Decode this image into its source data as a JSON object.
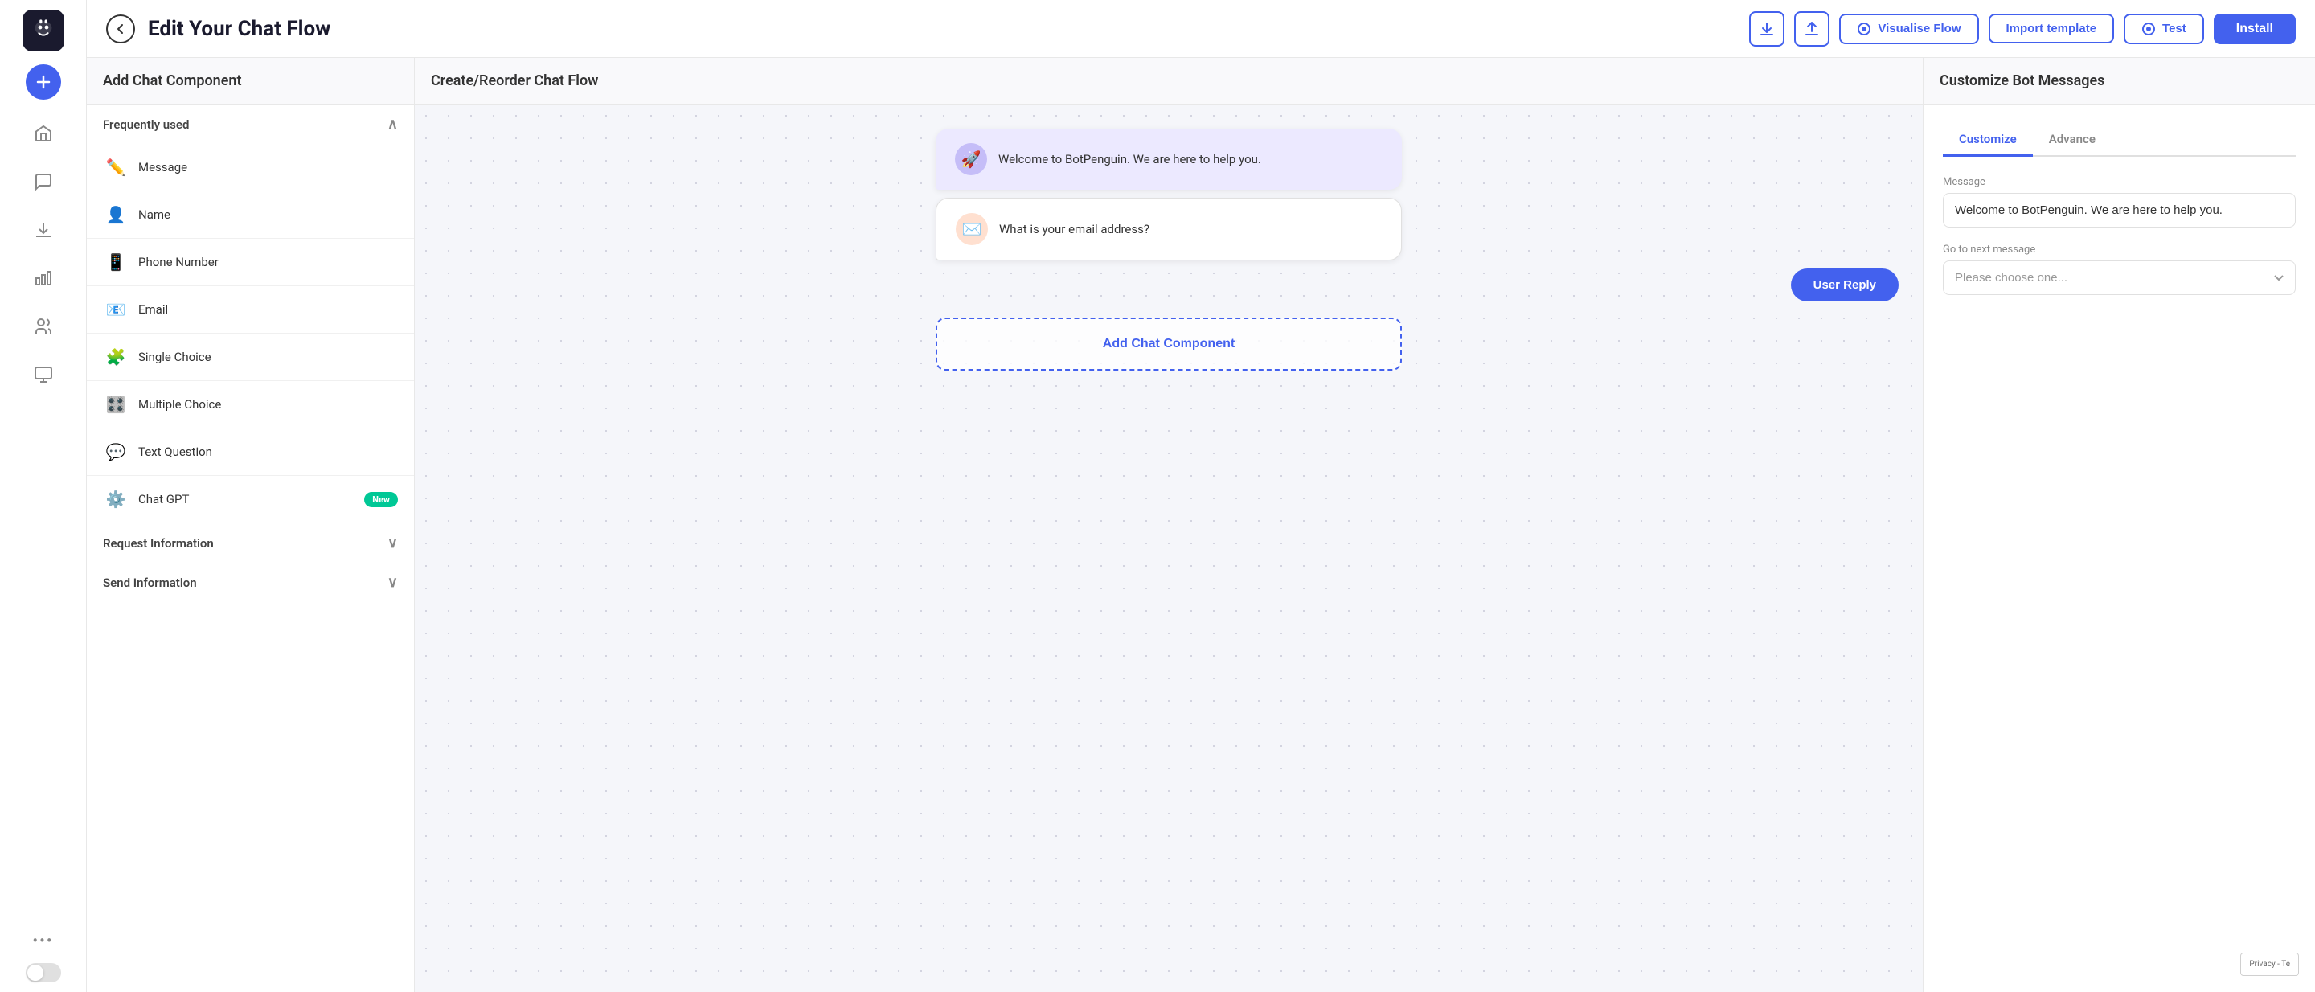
{
  "app": {
    "logo_alt": "BotPenguin Logo"
  },
  "sidebar": {
    "add_button_label": "+",
    "nav_items": [
      {
        "name": "home",
        "icon": "home"
      },
      {
        "name": "chat",
        "icon": "chat"
      },
      {
        "name": "download",
        "icon": "download"
      },
      {
        "name": "analytics",
        "icon": "analytics"
      },
      {
        "name": "users",
        "icon": "users"
      },
      {
        "name": "display",
        "icon": "display"
      }
    ],
    "more_label": "•••"
  },
  "header": {
    "title": "Edit Your Chat Flow",
    "back_label": "←",
    "download_icon": "download",
    "upload_icon": "upload",
    "visualise_btn": "Visualise Flow",
    "import_btn": "Import template",
    "test_btn": "Test",
    "install_btn": "Install"
  },
  "left_panel": {
    "title": "Add Chat Component",
    "sections": [
      {
        "name": "frequently_used",
        "label": "Frequently used",
        "expanded": true,
        "items": [
          {
            "name": "message",
            "label": "Message",
            "icon": "✏️"
          },
          {
            "name": "name",
            "label": "Name",
            "icon": "👤"
          },
          {
            "name": "phone_number",
            "label": "Phone Number",
            "icon": "📱"
          },
          {
            "name": "email",
            "label": "Email",
            "icon": "📧"
          },
          {
            "name": "single_choice",
            "label": "Single Choice",
            "icon": "🧩"
          },
          {
            "name": "multiple_choice",
            "label": "Multiple Choice",
            "icon": "🎛️"
          },
          {
            "name": "text_question",
            "label": "Text Question",
            "icon": "💬"
          },
          {
            "name": "chat_gpt",
            "label": "Chat GPT",
            "icon": "⚙️",
            "badge": "New"
          }
        ]
      },
      {
        "name": "request_information",
        "label": "Request Information",
        "expanded": false
      },
      {
        "name": "send_information",
        "label": "Send Information",
        "expanded": false
      }
    ]
  },
  "middle_panel": {
    "title": "Create/Reorder Chat Flow",
    "bubbles": [
      {
        "id": "bubble1",
        "type": "bot_welcome",
        "text": "Welcome to BotPenguin. We are here to help you.",
        "icon": "🚀"
      },
      {
        "id": "bubble2",
        "type": "bot_email",
        "text": "What is your email address?",
        "icon": "✉️"
      }
    ],
    "user_reply_label": "User Reply",
    "add_component_label": "Add Chat Component"
  },
  "right_panel": {
    "title": "Customize Bot Messages",
    "tabs": [
      {
        "name": "customize",
        "label": "Customize",
        "active": true
      },
      {
        "name": "advance",
        "label": "Advance",
        "active": false
      }
    ],
    "form": {
      "message_label": "Message",
      "message_value": "Welcome to BotPenguin. We are here to help you.",
      "next_message_label": "Go to next message",
      "next_message_placeholder": "Please choose one...",
      "next_message_options": [
        "Please choose one..."
      ]
    }
  },
  "recaptcha": {
    "text1": "Privacy - Te"
  }
}
